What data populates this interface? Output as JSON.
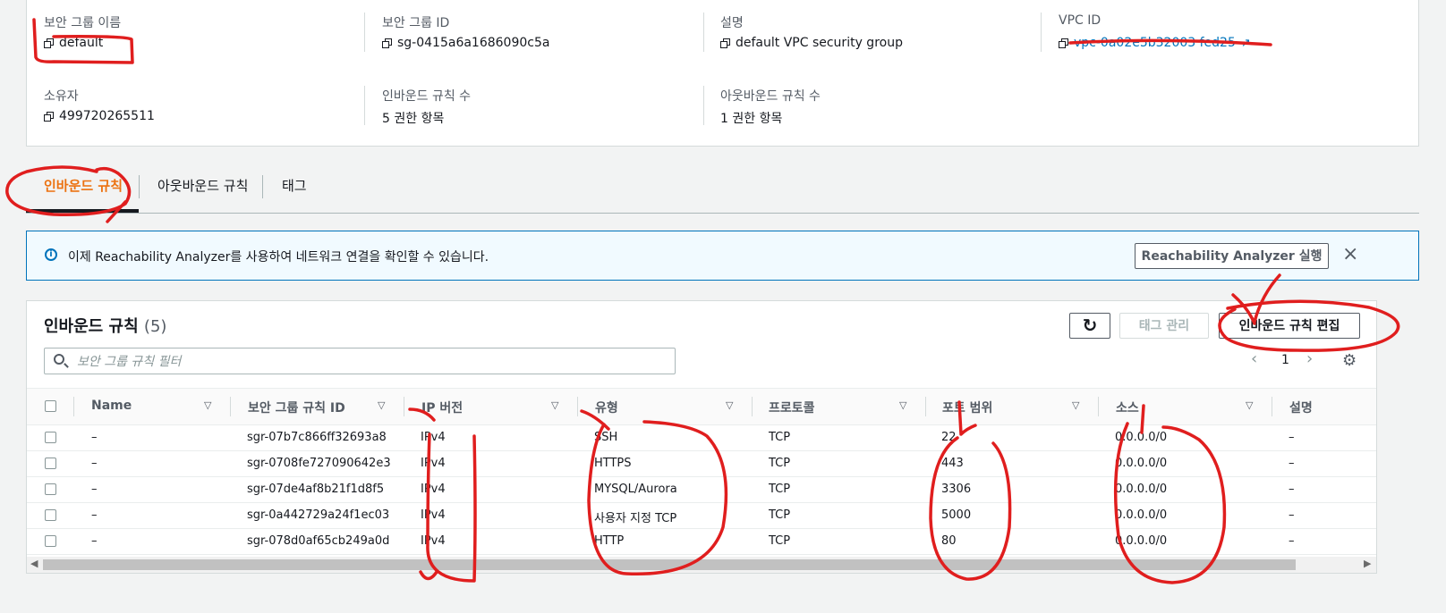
{
  "details": {
    "sg_name_label": "보안 그룹 이름",
    "sg_name_value": "default",
    "sg_id_label": "보안 그룹 ID",
    "sg_id_value": "sg-0415a6a1686090c5a",
    "description_label": "설명",
    "description_value": "default VPC security group",
    "vpc_id_label": "VPC ID",
    "vpc_id_value": "vpc-0a02e5b32003 fed25",
    "owner_label": "소유자",
    "owner_value": "499720265511",
    "inbound_count_label": "인바운드 규칙 수",
    "inbound_count_value": "5 권한 항목",
    "outbound_count_label": "아웃바운드 규칙 수",
    "outbound_count_value": "1 권한 항목"
  },
  "tabs": [
    {
      "label": "인바운드 규칙",
      "active": true
    },
    {
      "label": "아웃바운드 규칙",
      "active": false
    },
    {
      "label": "태그",
      "active": false
    }
  ],
  "banner": {
    "text": "이제 Reachability Analyzer를 사용하여 네트워크 연결을 확인할 수 있습니다.",
    "button_label": "Reachability Analyzer 실행",
    "close_icon": "×"
  },
  "rules": {
    "title": "인바운드 규칙",
    "count": "(5)",
    "refresh_icon": "↻",
    "manage_tags_label": "태그 관리",
    "edit_rules_label": "인바운드 규칙 편집",
    "search_placeholder": "보안 그룹 규칙 필터",
    "page_number": "1",
    "prev_icon": "‹",
    "next_icon": "›",
    "settings_icon": "⚙",
    "columns": [
      "Name",
      "보안 그룹 규칙 ID",
      "IP 버전",
      "유형",
      "프로토콜",
      "포트 범위",
      "소스",
      "설명"
    ],
    "rows": [
      {
        "name": "–",
        "id": "sgr-07b7c866ff32693a8",
        "ip": "IPv4",
        "type": "SSH",
        "protocol": "TCP",
        "port": "22",
        "source": "0.0.0.0/0",
        "desc": "–"
      },
      {
        "name": "–",
        "id": "sgr-0708fe727090642e3",
        "ip": "IPv4",
        "type": "HTTPS",
        "protocol": "TCP",
        "port": "443",
        "source": "0.0.0.0/0",
        "desc": "–"
      },
      {
        "name": "–",
        "id": "sgr-07de4af8b21f1d8f5",
        "ip": "IPv4",
        "type": "MYSQL/Aurora",
        "protocol": "TCP",
        "port": "3306",
        "source": "0.0.0.0/0",
        "desc": "–"
      },
      {
        "name": "–",
        "id": "sgr-0a442729a24f1ec03",
        "ip": "IPv4",
        "type": "사용자 지정 TCP",
        "protocol": "TCP",
        "port": "5000",
        "source": "0.0.0.0/0",
        "desc": "–"
      },
      {
        "name": "–",
        "id": "sgr-078d0af65cb249a0d",
        "ip": "IPv4",
        "type": "HTTP",
        "protocol": "TCP",
        "port": "80",
        "source": "0.0.0.0/0",
        "desc": "–"
      }
    ]
  },
  "colors": {
    "accent": "#ec7211",
    "info": "#0073bb",
    "annotation": "#e01e1e"
  }
}
